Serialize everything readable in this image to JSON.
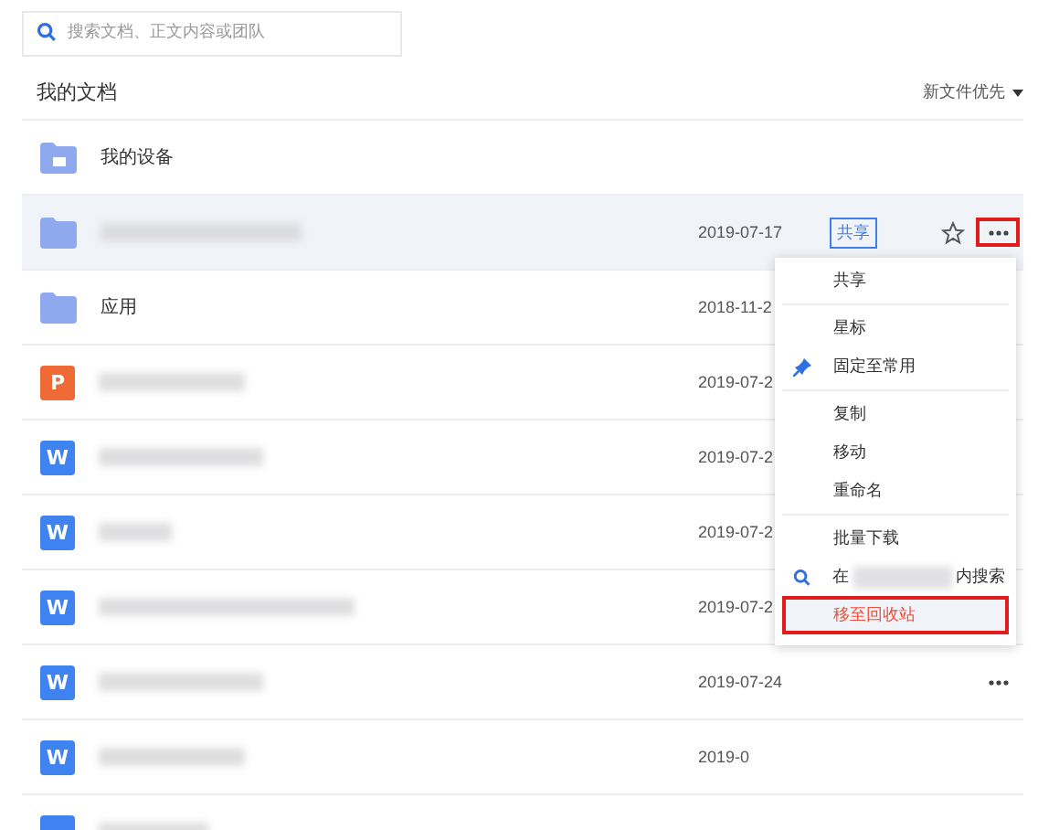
{
  "search": {
    "placeholder": "搜索文档、正文内容或团队"
  },
  "header": {
    "title": "我的文档",
    "sort": "新文件优先"
  },
  "rows": [
    {
      "kind": "device",
      "name": "我的设备",
      "selected": false
    },
    {
      "kind": "folder",
      "date": "2019-07-17",
      "tag": "共享",
      "starrable": true,
      "more": true,
      "selected": true
    },
    {
      "kind": "folder",
      "name": "应用",
      "date": "2018-11-2",
      "selected": false
    },
    {
      "kind": "doc",
      "badge": "P",
      "color": "#f06a35",
      "date": "2019-07-2",
      "selected": false
    },
    {
      "kind": "doc",
      "badge": "W",
      "color": "#3f83f0",
      "date": "2019-07-2",
      "selected": false
    },
    {
      "kind": "doc",
      "badge": "W",
      "color": "#3f83f0",
      "date": "2019-07-2",
      "selected": false
    },
    {
      "kind": "doc",
      "badge": "W",
      "color": "#3f83f0",
      "date": "2019-07-2",
      "selected": false
    },
    {
      "kind": "doc",
      "badge": "W",
      "color": "#3f83f0",
      "date": "2019-07-24",
      "more": true,
      "selected": false
    },
    {
      "kind": "doc",
      "badge": "W",
      "color": "#3f83f0",
      "date": "2019-0",
      "selected": false
    },
    {
      "kind": "doc",
      "color": "#3f83f0",
      "selected": false
    }
  ],
  "menu": {
    "groups": [
      [
        {
          "kind": "plain",
          "label": "共享"
        }
      ],
      [
        {
          "kind": "plain",
          "label": "星标"
        },
        {
          "kind": "pin",
          "label": "固定至常用"
        }
      ],
      [
        {
          "kind": "plain",
          "label": "复制"
        },
        {
          "kind": "plain",
          "label": "移动"
        },
        {
          "kind": "plain",
          "label": "重命名"
        }
      ],
      [
        {
          "kind": "plain",
          "label": "批量下载"
        },
        {
          "kind": "search",
          "label": "在",
          "suffix": "内搜索"
        },
        {
          "kind": "danger",
          "label": "移至回收站",
          "highlighted": true
        }
      ]
    ]
  }
}
